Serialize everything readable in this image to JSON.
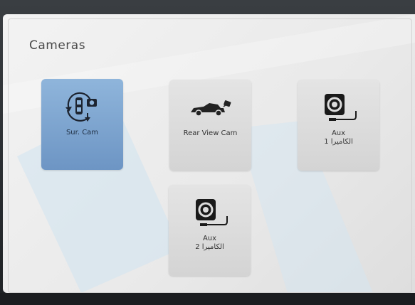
{
  "screen": {
    "title": "Cameras"
  },
  "tiles": [
    {
      "label": "Sur. Cam",
      "sublabel": "",
      "icon": "surround-camera-icon",
      "selected": true
    },
    {
      "label": "Rear View Cam",
      "sublabel": "",
      "icon": "rear-view-car-icon",
      "selected": false
    },
    {
      "label": "Aux",
      "sublabel": "الكاميرا 1",
      "icon": "aux-camera-icon",
      "selected": false
    },
    {
      "label": "Aux",
      "sublabel": "الكاميرا 2",
      "icon": "aux-camera-icon",
      "selected": false
    }
  ],
  "colors": {
    "selected_tile": "#7ea5d0",
    "tile": "#dcdcdc",
    "screen_bg": "#efefef"
  }
}
